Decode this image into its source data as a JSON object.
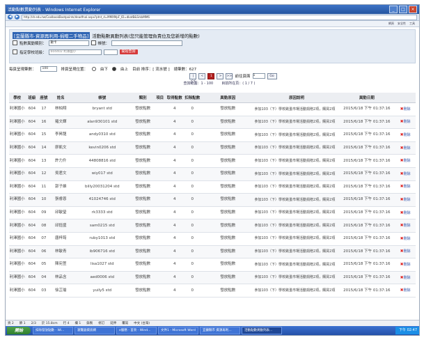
{
  "window": {
    "title": "活動點數異動列表 - Windows Internet Explorer",
    "url": "http://dr.edu.tw/CoolbookBootpoints/deadfnal.aspx?ptnt_d=MMXMpF_ID=dkatB&SrkbMM6",
    "toolbar_items": [
      "工具",
      "網頁",
      "安全性"
    ]
  },
  "filter": {
    "head_link": "[宜蘭縣市-資源再利用-捐贈二手物品]",
    "head_title": "活動點數異動列表(您只能管理負責位及您新增的點數)",
    "row1_label": "點數異動類別：",
    "row1_select": "數卡",
    "row1_label2": "帳號：",
    "row2_label": "指定學校班級：",
    "row2_select": "604402 利澤國小",
    "search_button": "開始查詢"
  },
  "pager": {
    "per_page_label": "每頁呈現筆數：",
    "per_page_value": "100",
    "sort_label": "排頁呈現位置：",
    "sort_opt_down": "由下",
    "sort_opt_up": "由上",
    "sort_info": "目前 排序：[ 流水號 ]",
    "total": "總筆數：627",
    "first": "|<<",
    "prev": "<",
    "current": "1",
    "next": ">",
    "last": ">>|",
    "goto_label": "前往頁面",
    "goto_value": "1",
    "go_button": "Go",
    "range": "查詢範圍：1 - 100",
    "page_pos": "目前所在頁：( 1 / 7 )"
  },
  "table": {
    "headers": [
      "學校",
      "班級",
      "座號",
      "姓名",
      "帳號",
      "類別",
      "項目",
      "取得點數",
      "扣除點數",
      "異動原因",
      "原因說明",
      "異動日期",
      ""
    ],
    "rows": [
      {
        "school": "利澤國小",
        "grade": "604",
        "seat": "17",
        "name": "林柏翔",
        "acct": "bryant std",
        "cat": "發放點數",
        "item": "",
        "get": "4",
        "minus": "0",
        "reason": "發放點數",
        "desc": "參加103（下）學校跳蚤市場活動捐贈2項，購買2項",
        "date": "2015/6/18 下午 01:37:16",
        "act": "刪除"
      },
      {
        "school": "利澤國小",
        "grade": "604",
        "seat": "16",
        "name": "羅文輝",
        "acct": "alan930101 std",
        "cat": "發放點數",
        "item": "",
        "get": "4",
        "minus": "0",
        "reason": "發放點數",
        "desc": "參加103（下）學校跳蚤市場活動捐贈2項，購買2項",
        "date": "2015/6/18 下午 01:37:16",
        "act": "刪除"
      },
      {
        "school": "利澤國小",
        "grade": "604",
        "seat": "15",
        "name": "李昇龍",
        "acct": "andy0310 std",
        "cat": "發放點數",
        "item": "",
        "get": "4",
        "minus": "0",
        "reason": "發放點數",
        "desc": "參加103（下）學校跳蚤市場活動捐贈2項，購買2項",
        "date": "2015/6/18 下午 01:37:16",
        "act": "刪除"
      },
      {
        "school": "利澤國小",
        "grade": "604",
        "seat": "14",
        "name": "廖凱文",
        "acct": "kevin0206 std",
        "cat": "發放點數",
        "item": "",
        "get": "4",
        "minus": "0",
        "reason": "發放點數",
        "desc": "參加103（下）學校跳蚤市場活動捐贈2項，購買2項",
        "date": "2015/6/18 下午 01:37:16",
        "act": "刪除"
      },
      {
        "school": "利澤國小",
        "grade": "604",
        "seat": "13",
        "name": "許力升",
        "acct": "44808816 std",
        "cat": "發放點數",
        "item": "",
        "get": "4",
        "minus": "0",
        "reason": "發放點數",
        "desc": "參加103（下）學校跳蚤市場活動捐贈2項，購買2項",
        "date": "2015/6/18 下午 01:37:16",
        "act": "刪除"
      },
      {
        "school": "利澤國小",
        "grade": "604",
        "seat": "12",
        "name": "吳君文",
        "acct": "wiy017 std",
        "cat": "發放點數",
        "item": "",
        "get": "4",
        "minus": "0",
        "reason": "發放點數",
        "desc": "參加103（下）學校跳蚤市場活動捐贈2項，購買2項",
        "date": "2015/6/18 下午 01:37:16",
        "act": "刪除"
      },
      {
        "school": "利澤國小",
        "grade": "604",
        "seat": "11",
        "name": "郭子維",
        "acct": "billy20031204 std",
        "cat": "發放點數",
        "item": "",
        "get": "4",
        "minus": "0",
        "reason": "發放點數",
        "desc": "參加103（下）學校跳蚤市場活動捐贈2項，購買2項",
        "date": "2015/6/18 下午 01:37:16",
        "act": "刪除"
      },
      {
        "school": "利澤國小",
        "grade": "604",
        "seat": "10",
        "name": "張睿恩",
        "acct": "41024746 std",
        "cat": "發放點數",
        "item": "",
        "get": "4",
        "minus": "0",
        "reason": "發放點數",
        "desc": "參加103（下）學校跳蚤市場活動捐贈2項，購買2項",
        "date": "2015/6/18 下午 01:37:16",
        "act": "刪除"
      },
      {
        "school": "利澤國小",
        "grade": "604",
        "seat": "09",
        "name": "邱敏瑩",
        "acct": "rk3333 std",
        "cat": "發放點數",
        "item": "",
        "get": "4",
        "minus": "0",
        "reason": "發放點數",
        "desc": "參加103（下）學校跳蚤市場活動捐贈2項，購買2項",
        "date": "2015/6/18 下午 01:37:16",
        "act": "刪除"
      },
      {
        "school": "利澤國小",
        "grade": "604",
        "seat": "08",
        "name": "邱鈺盛",
        "acct": "sam0215 std",
        "cat": "發放點數",
        "item": "",
        "get": "4",
        "minus": "0",
        "reason": "發放點數",
        "desc": "參加103（下）學校跳蚤市場活動捐贈2項，購買2項",
        "date": "2015/6/18 下午 01:37:16",
        "act": "刪除"
      },
      {
        "school": "利澤國小",
        "grade": "604",
        "seat": "07",
        "name": "唐梓筠",
        "acct": "ruby1013 std",
        "cat": "發放點數",
        "item": "",
        "get": "4",
        "minus": "0",
        "reason": "發放點數",
        "desc": "參加103（下）學校跳蚤市場活動捐贈2項，購買2項",
        "date": "2015/6/18 下午 01:37:16",
        "act": "刪除"
      },
      {
        "school": "利澤國小",
        "grade": "604",
        "seat": "06",
        "name": "林敏青",
        "acct": "ib906716 std",
        "cat": "發放點數",
        "item": "",
        "get": "4",
        "minus": "0",
        "reason": "發放點數",
        "desc": "參加103（下）學校跳蚤市場活動捐贈2項，購買2項",
        "date": "2015/6/18 下午 01:37:16",
        "act": "刪除"
      },
      {
        "school": "利澤國小",
        "grade": "604",
        "seat": "05",
        "name": "陳宛萱",
        "acct": "lisa1027 std",
        "cat": "發放點數",
        "item": "",
        "get": "4",
        "minus": "0",
        "reason": "發放點數",
        "desc": "參加103（下）學校跳蚤市場活動捐贈2項，購買2項",
        "date": "2015/6/18 下午 01:37:16",
        "act": "刪除"
      },
      {
        "school": "利澤國小",
        "grade": "604",
        "seat": "04",
        "name": "林品含",
        "acct": "aed0006 std",
        "cat": "發放點數",
        "item": "",
        "get": "4",
        "minus": "0",
        "reason": "發放點數",
        "desc": "參加103（下）學校跳蚤市場活動捐贈2項，購買2項",
        "date": "2015/6/18 下午 01:37:16",
        "act": "刪除"
      },
      {
        "school": "利澤國小",
        "grade": "604",
        "seat": "03",
        "name": "徐芷瑜",
        "acct": "yuily5 std",
        "cat": "發放點數",
        "item": "",
        "get": "4",
        "minus": "0",
        "reason": "發放點數",
        "desc": "參加103（下）學校跳蚤市場活動捐贈2項，購買2項",
        "date": "2015/6/18 下午 01:37:16",
        "act": "刪除"
      }
    ]
  },
  "statusbar": {
    "items": [
      "頁 2",
      "節 1",
      "2/3",
      "於 15.8cm",
      "行 4",
      "欄 1",
      "錄製",
      "修訂",
      "延伸",
      "覆寫",
      "中文 (台灣)"
    ]
  },
  "taskbar": {
    "start": "開始",
    "tasks": [
      "扣除發放點數 - Wi...",
      "瀏覽器資訊網",
      "e服務 - 首頁 - Wind...",
      "文件1 - Microsoft Word",
      "宜蘭縣市 資源再利...",
      "活動點數異動列表..."
    ],
    "clock": "下午 02:47"
  }
}
